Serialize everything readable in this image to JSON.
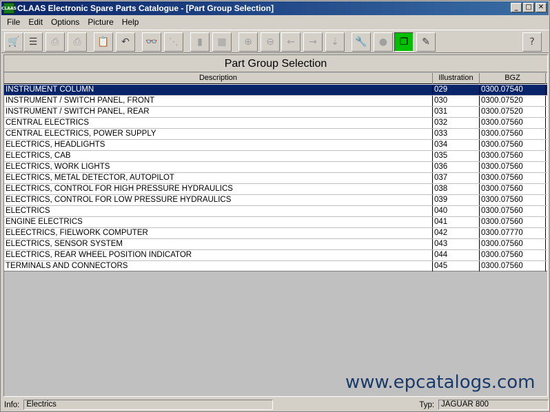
{
  "window": {
    "title": "CLAAS Electronic Spare Parts Catalogue - [Part Group Selection]",
    "minimize": "_",
    "maximize": "□",
    "close": "✕"
  },
  "menu": [
    "File",
    "Edit",
    "Options",
    "Picture",
    "Help"
  ],
  "toolbar": {
    "buttons": [
      {
        "icon": "cart-icon",
        "glyph": "🛒",
        "enabled": false
      },
      {
        "icon": "list-icon",
        "glyph": "☰",
        "enabled": true
      },
      {
        "icon": "stamp-icon",
        "glyph": "⎙",
        "enabled": false
      },
      {
        "icon": "print-icon",
        "glyph": "⎙",
        "enabled": false
      },
      {
        "icon": "clipboard-icon",
        "glyph": "📋",
        "enabled": true
      },
      {
        "icon": "undo-icon",
        "glyph": "↶",
        "enabled": true
      },
      {
        "icon": "binoculars-icon",
        "glyph": "👓",
        "enabled": true
      },
      {
        "icon": "tree-icon",
        "glyph": "⋱",
        "enabled": false
      },
      {
        "icon": "page-icon",
        "glyph": "▮",
        "enabled": false
      },
      {
        "icon": "grid-icon",
        "glyph": "▦",
        "enabled": false
      },
      {
        "icon": "zoom-in-icon",
        "glyph": "⊕",
        "enabled": false
      },
      {
        "icon": "zoom-out-icon",
        "glyph": "⊖",
        "enabled": false
      },
      {
        "icon": "arrow-left-icon",
        "glyph": "←",
        "enabled": false
      },
      {
        "icon": "arrow-right-icon",
        "glyph": "→",
        "enabled": false
      },
      {
        "icon": "page-down-icon",
        "glyph": "⇣",
        "enabled": false
      },
      {
        "icon": "wrench-icon",
        "glyph": "🔧",
        "enabled": false
      },
      {
        "icon": "circle-icon",
        "glyph": "●",
        "enabled": false
      },
      {
        "icon": "windows-icon",
        "glyph": "❐",
        "enabled": true,
        "active": true
      },
      {
        "icon": "tools-icon",
        "glyph": "✎",
        "enabled": true
      },
      {
        "icon": "help-icon",
        "glyph": "?",
        "enabled": true
      }
    ]
  },
  "panel": {
    "title": "Part Group Selection"
  },
  "table": {
    "headers": [
      "Description",
      "Illustration",
      "BGZ"
    ],
    "rows": [
      {
        "description": "INSTRUMENT COLUMN",
        "illustration": "029",
        "bgz": "0300.07540",
        "selected": true
      },
      {
        "description": "INSTRUMENT / SWITCH PANEL,  FRONT",
        "illustration": "030",
        "bgz": "0300.07520"
      },
      {
        "description": "INSTRUMENT / SWITCH PANEL,  REAR",
        "illustration": "031",
        "bgz": "0300.07520"
      },
      {
        "description": "CENTRAL ELECTRICS",
        "illustration": "032",
        "bgz": "0300.07560"
      },
      {
        "description": "CENTRAL ELECTRICS,  POWER SUPPLY",
        "illustration": "033",
        "bgz": "0300.07560"
      },
      {
        "description": "ELECTRICS,  HEADLIGHTS",
        "illustration": "034",
        "bgz": "0300.07560"
      },
      {
        "description": "ELECTRICS,  CAB",
        "illustration": "035",
        "bgz": "0300.07560"
      },
      {
        "description": "ELECTRICS,  WORK LIGHTS",
        "illustration": "036",
        "bgz": "0300.07560"
      },
      {
        "description": "ELECTRICS,  METAL DETECTOR, AUTOPILOT",
        "illustration": "037",
        "bgz": "0300.07560"
      },
      {
        "description": "ELECTRICS,  CONTROL FOR HIGH PRESSURE HYDRAULICS",
        "illustration": "038",
        "bgz": "0300.07560"
      },
      {
        "description": "ELECTRICS,  CONTROL FOR LOW PRESSURE HYDRAULICS",
        "illustration": "039",
        "bgz": "0300.07560"
      },
      {
        "description": "ELECTRICS",
        "illustration": "040",
        "bgz": "0300.07560"
      },
      {
        "description": "ENGINE ELECTRICS",
        "illustration": "041",
        "bgz": "0300.07560"
      },
      {
        "description": "ELEECTRICS,  FIELWORK COMPUTER",
        "illustration": "042",
        "bgz": "0300.07770"
      },
      {
        "description": "ELECTRICS,  SENSOR SYSTEM",
        "illustration": "043",
        "bgz": "0300.07560"
      },
      {
        "description": "ELECTRICS,  REAR WHEEL POSITION INDICATOR",
        "illustration": "044",
        "bgz": "0300.07560"
      },
      {
        "description": "TERMINALS AND CONNECTORS",
        "illustration": "045",
        "bgz": "0300.07560"
      }
    ]
  },
  "watermark": "www.epcatalogs.com",
  "status": {
    "info_label": "Info:",
    "info_value": "Electrics",
    "typ_label": "Typ:",
    "typ_value": "JAGUAR 800"
  }
}
